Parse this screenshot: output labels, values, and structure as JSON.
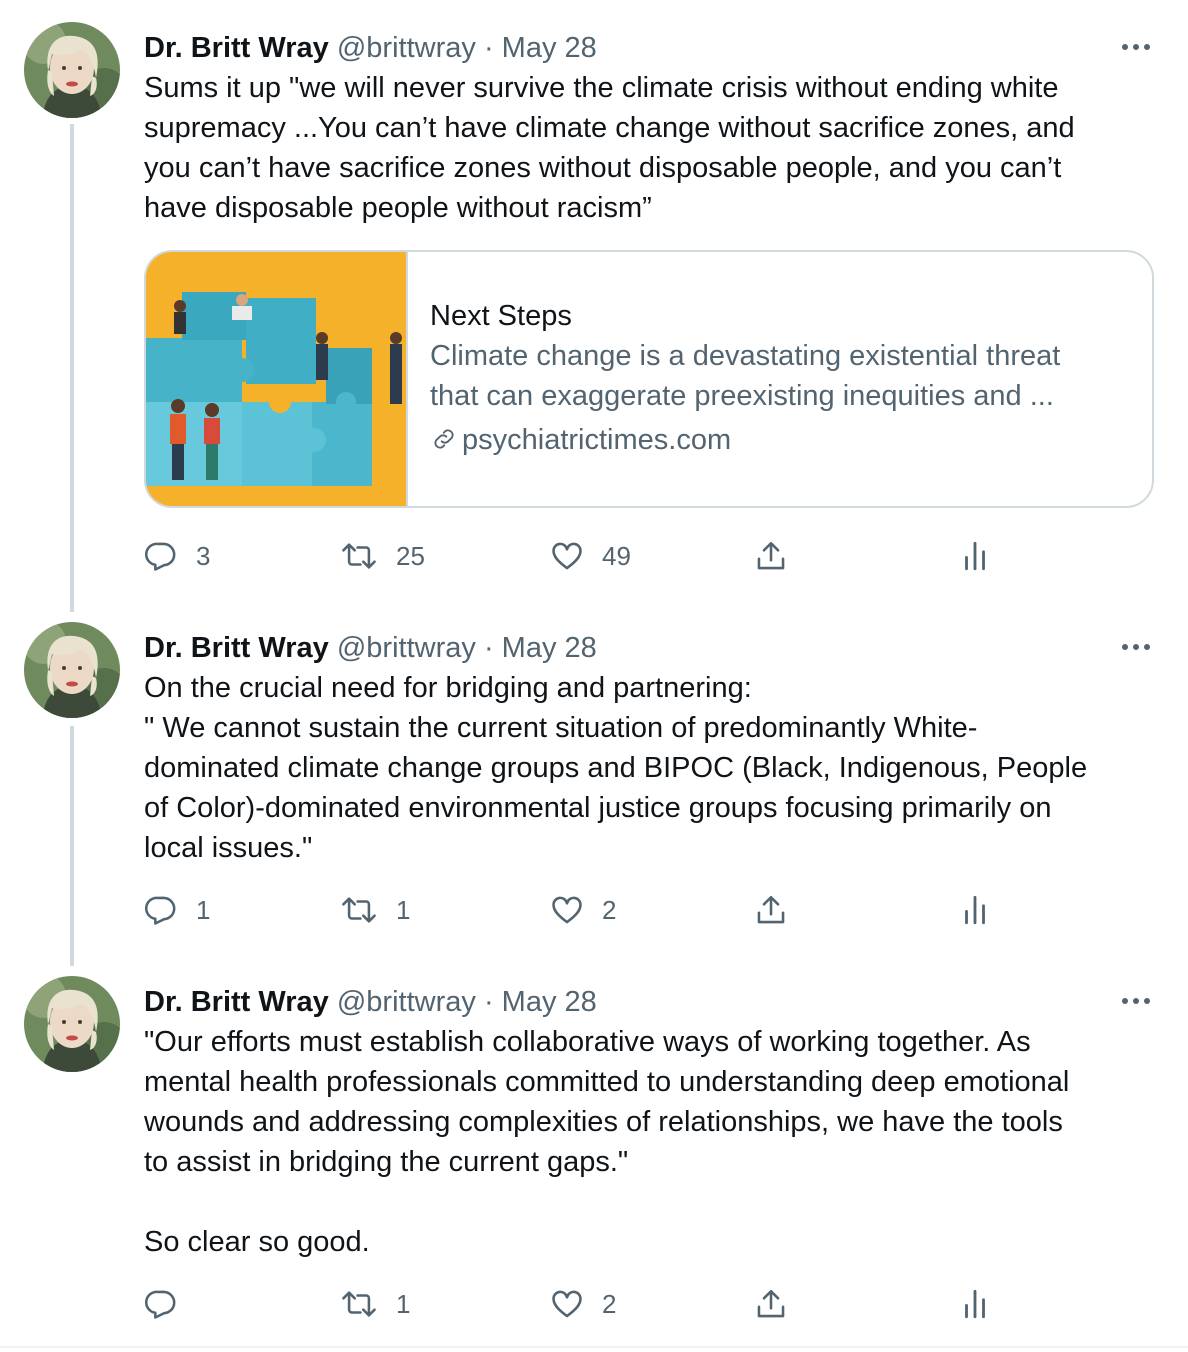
{
  "thread": [
    {
      "author": {
        "name": "Dr. Britt Wray",
        "handle": "@brittwray"
      },
      "separator": "·",
      "date": "May 28",
      "text_lines": [
        "Sums it up \"we will never survive the climate crisis without ending white",
        "supremacy ...You can’t have climate change without sacrifice zones, and",
        "you can’t have sacrifice zones without disposable people, and you can’t",
        "have disposable people without racism”"
      ],
      "card": {
        "title": "Next Steps",
        "description_lines": [
          "Climate change is a devastating existential threat",
          "that can exaggerate preexisting inequities and ..."
        ],
        "domain": "psychiatrictimes.com"
      },
      "stats": {
        "replies": "3",
        "retweets": "25",
        "likes": "49"
      }
    },
    {
      "author": {
        "name": "Dr. Britt Wray",
        "handle": "@brittwray"
      },
      "separator": "·",
      "date": "May 28",
      "text_lines": [
        "On the crucial need for bridging and partnering:",
        "\" We cannot sustain the current situation of predominantly White-",
        "dominated climate change groups and BIPOC (Black, Indigenous, People",
        "of Color)-dominated environmental justice groups focusing primarily on",
        "local issues.\""
      ],
      "stats": {
        "replies": "1",
        "retweets": "1",
        "likes": "2"
      }
    },
    {
      "author": {
        "name": "Dr. Britt Wray",
        "handle": "@brittwray"
      },
      "separator": "·",
      "date": "May 28",
      "text_lines": [
        "\"Our efforts must establish collaborative ways of working together. As",
        "mental health professionals committed to understanding deep emotional",
        "wounds and addressing complexities of relationships, we have the tools",
        "to assist in bridging the current gaps.\"",
        "",
        "So clear so good."
      ],
      "stats": {
        "replies": "",
        "retweets": "1",
        "likes": "2"
      }
    }
  ],
  "icons": {
    "reply": "reply-icon",
    "retweet": "retweet-icon",
    "like": "heart-icon",
    "share": "share-icon",
    "analytics": "analytics-icon",
    "more": "more-icon",
    "link": "link-icon"
  },
  "colors": {
    "text": "#0f1419",
    "secondary": "#536471",
    "border": "#cfd9de",
    "card_image_bg": "#f6b12a"
  }
}
